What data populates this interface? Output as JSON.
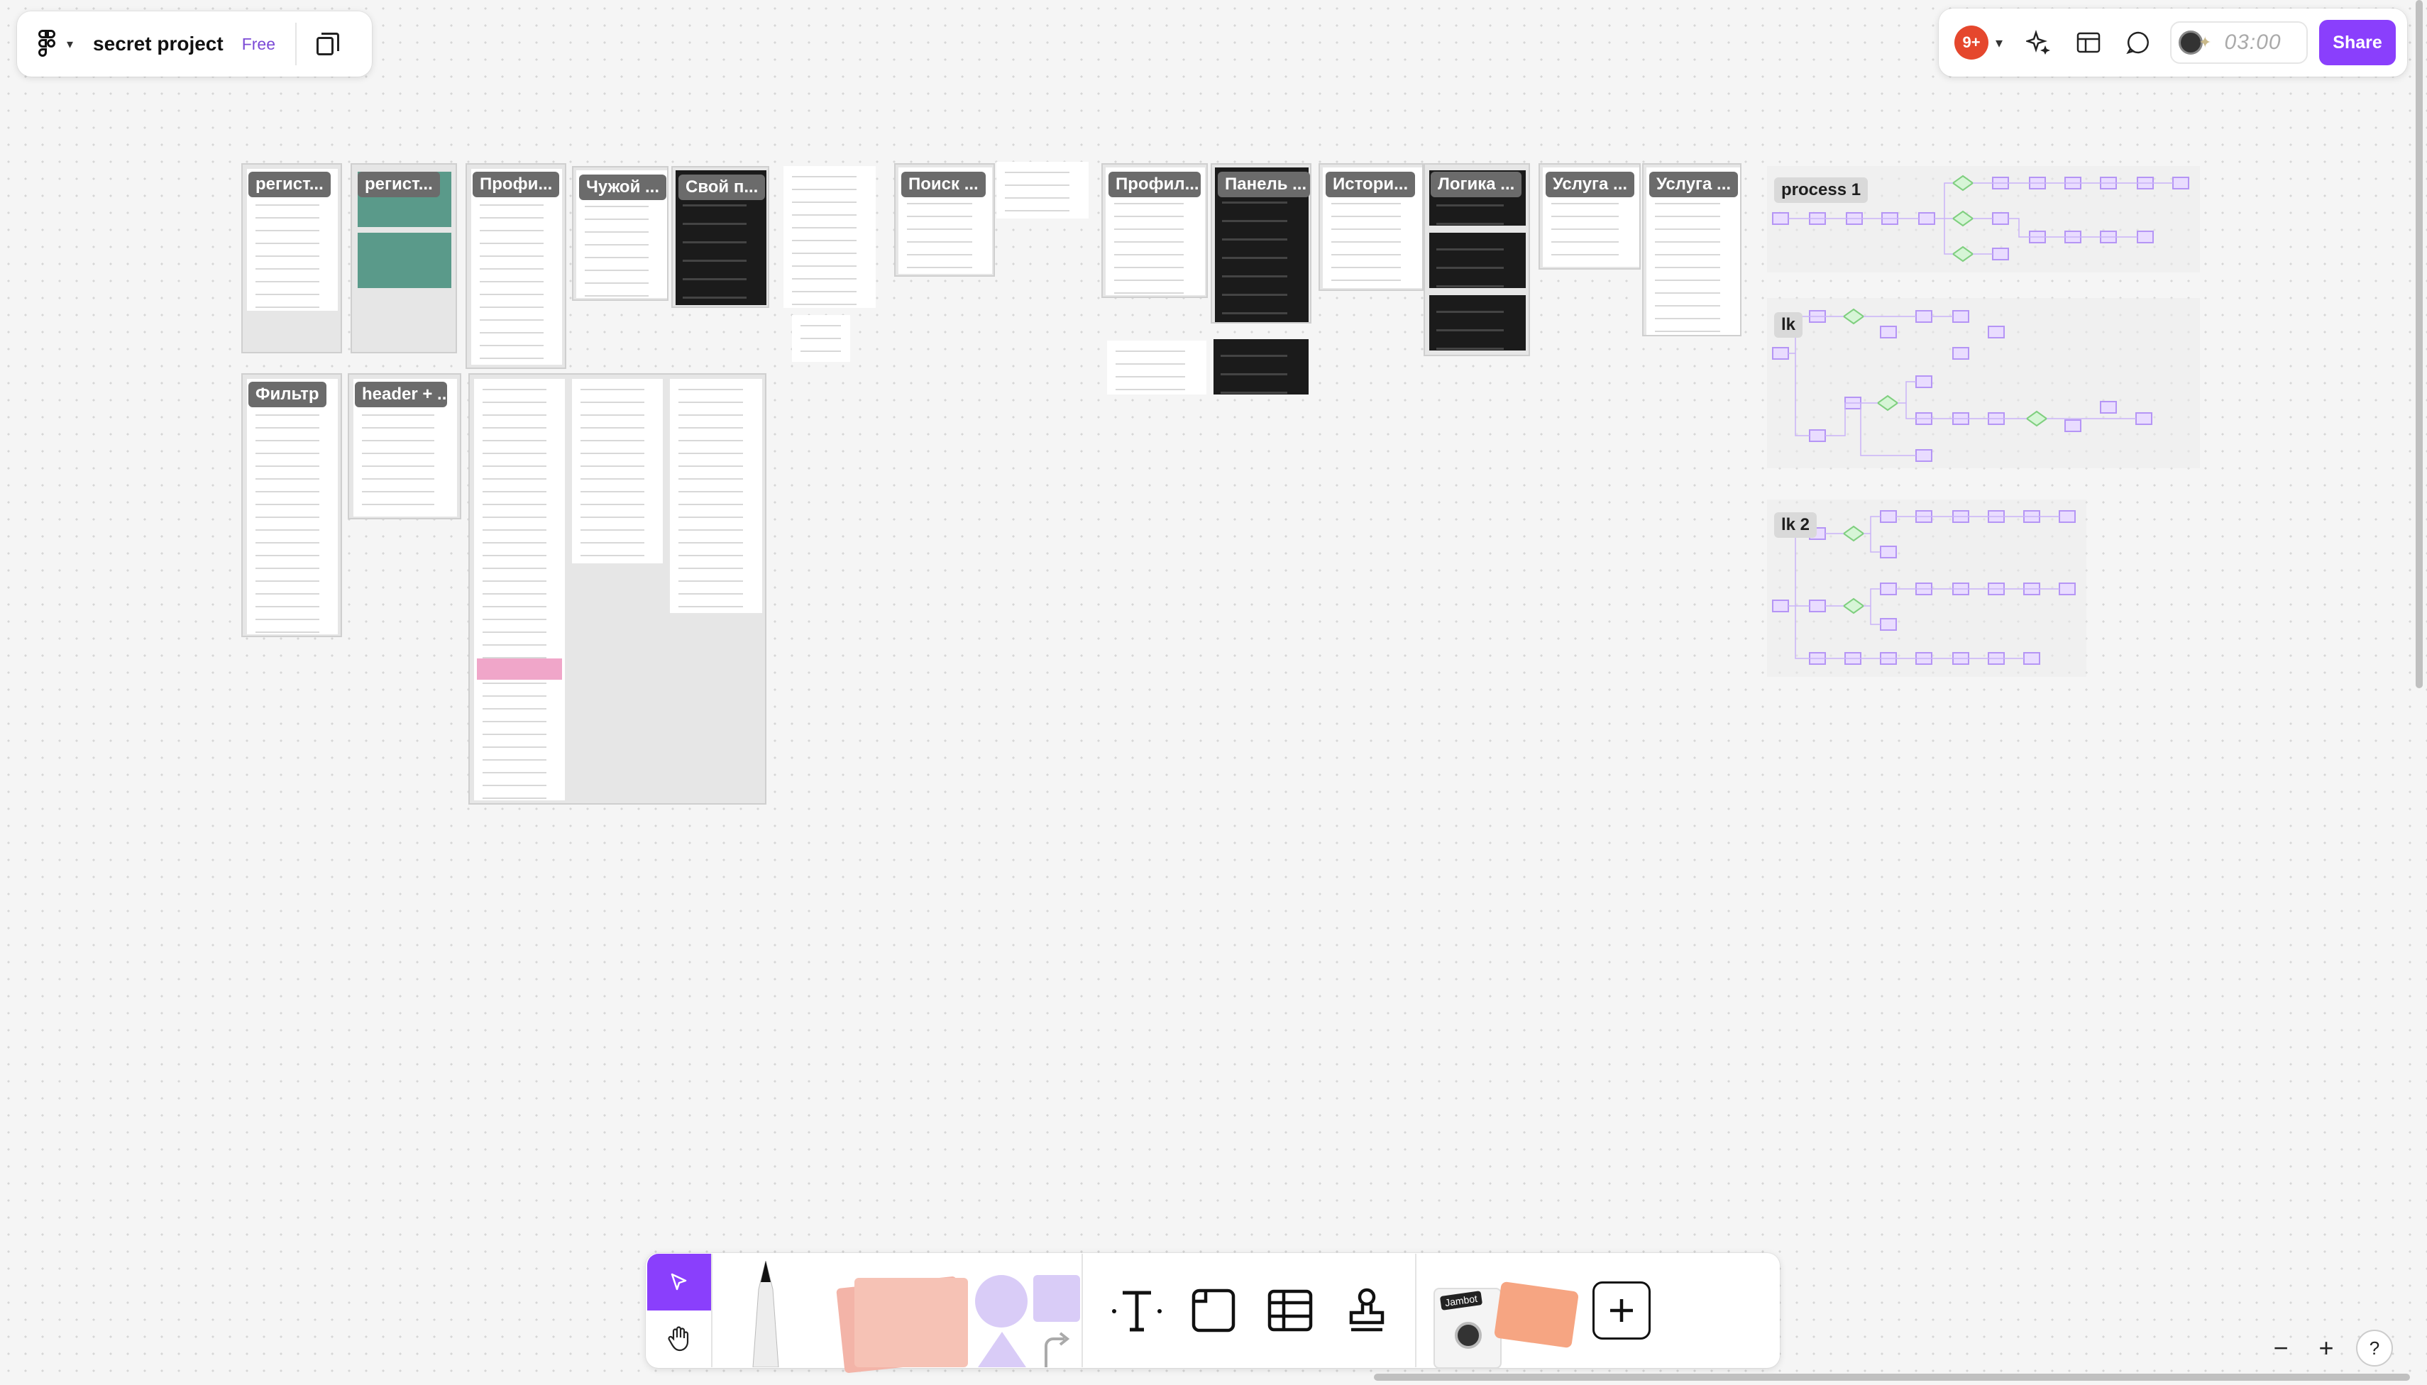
{
  "file": {
    "name": "secret project",
    "plan_badge": "Free"
  },
  "header_right": {
    "notifications": "9+",
    "timer": "03:00",
    "share_label": "Share"
  },
  "frames": [
    {
      "label": "регист..."
    },
    {
      "label": "регист..."
    },
    {
      "label": "Профи..."
    },
    {
      "label": "Чужой ..."
    },
    {
      "label": "Свой п..."
    },
    {
      "label": "Поиск ..."
    },
    {
      "label": "Профил..."
    },
    {
      "label": "Панель ..."
    },
    {
      "label": "Истори..."
    },
    {
      "label": "Логика ..."
    },
    {
      "label": "Услуга ..."
    },
    {
      "label": "Услуга ..."
    },
    {
      "label": "Фильтр"
    },
    {
      "label": "header + ..."
    }
  ],
  "flows": [
    {
      "label": "process 1"
    },
    {
      "label": "lk"
    },
    {
      "label": "lk 2"
    }
  ],
  "toolbar": {
    "jambot_label": "Jambot"
  },
  "zoom": {
    "minus": "−",
    "plus": "+",
    "help": "?"
  },
  "colors": {
    "accent": "#8a3ffc",
    "notification": "#e5472d",
    "canvas": "#f5f5f5"
  }
}
